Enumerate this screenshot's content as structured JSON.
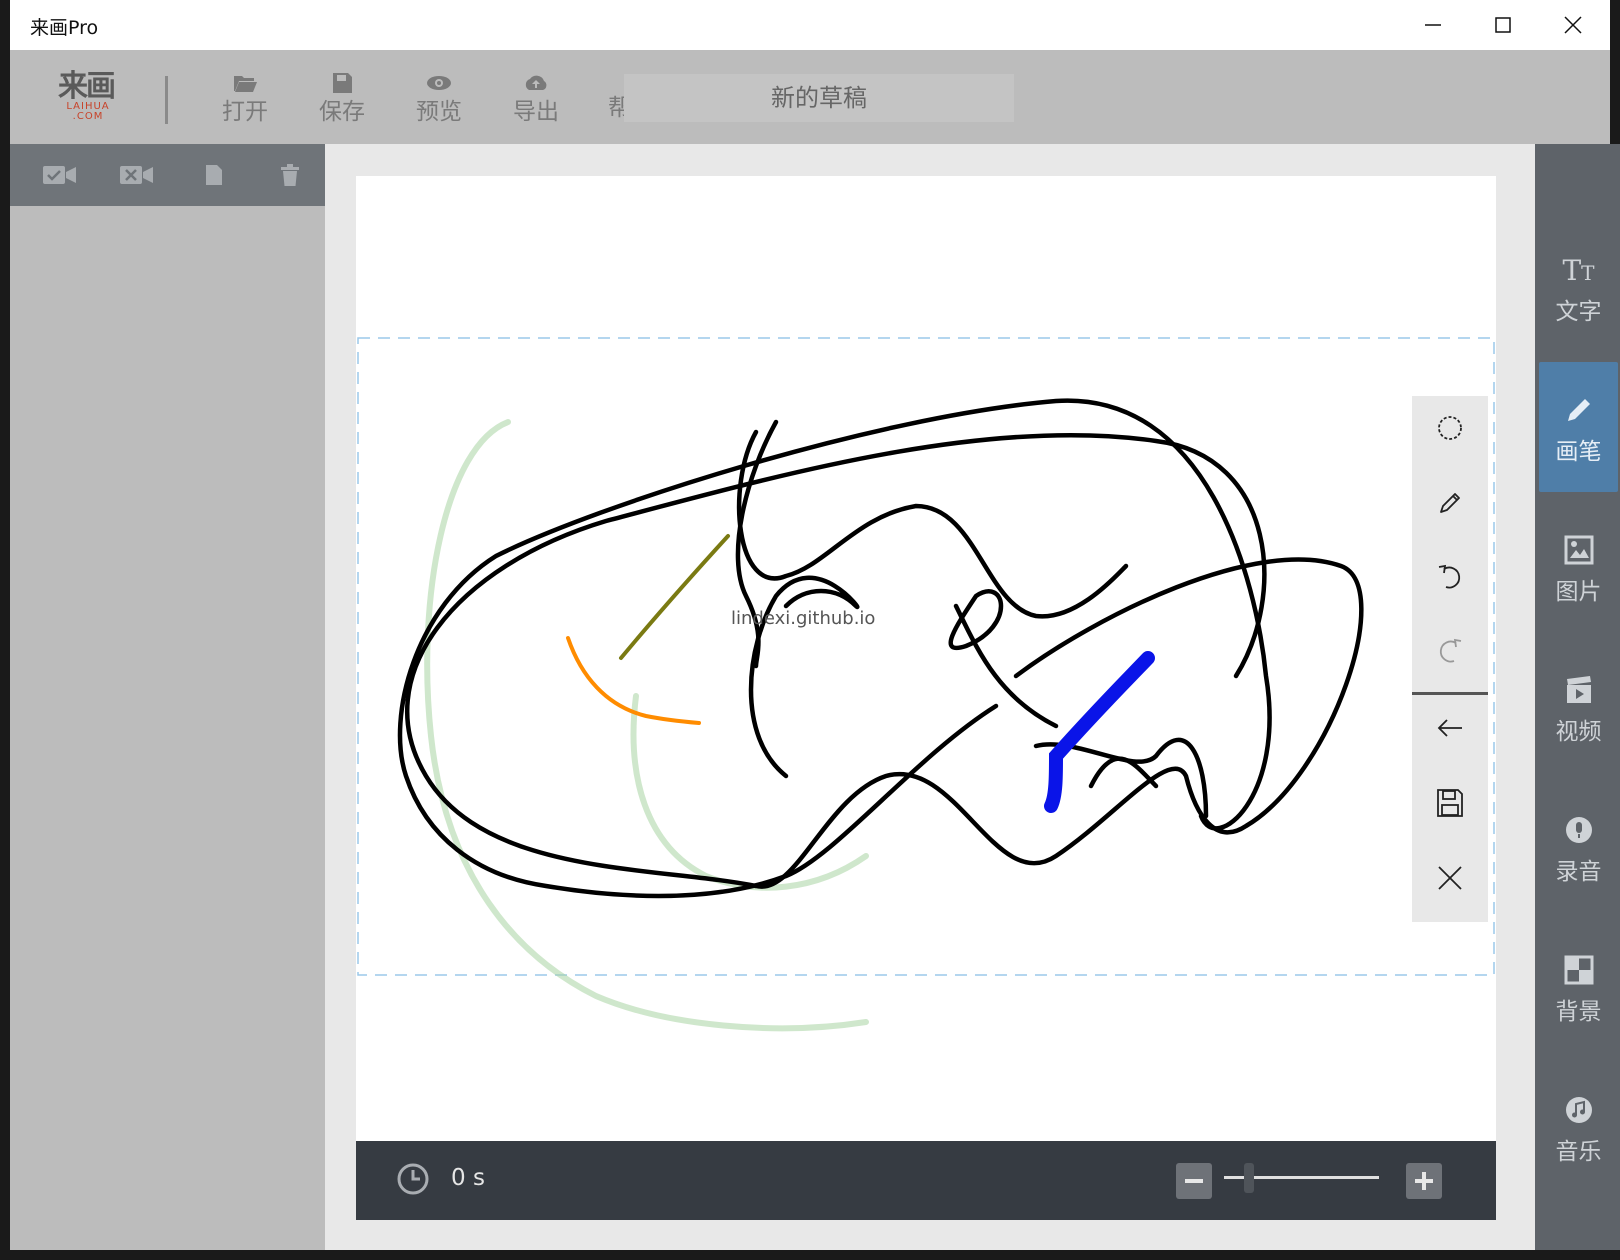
{
  "window": {
    "title": "来画Pro"
  },
  "toolbar": {
    "logo_cn": "来画",
    "logo_en": "LAIHUA",
    "logo_com": ".COM",
    "buttons": [
      {
        "label": "打开",
        "icon": "folder-open-icon"
      },
      {
        "label": "保存",
        "icon": "save-icon"
      },
      {
        "label": "预览",
        "icon": "eye-icon"
      },
      {
        "label": "导出",
        "icon": "cloud-upload-icon"
      },
      {
        "label": "帮助",
        "icon": "help-icon"
      }
    ],
    "document_title": "新的草稿"
  },
  "left_panel": {
    "tools": [
      "video-check-icon",
      "video-cross-icon",
      "page-icon",
      "trash-icon"
    ]
  },
  "canvas": {
    "watermark": "lindexi.github.io",
    "stroke_colors": {
      "ink": "#000000",
      "faint_green": "#a8d4a3",
      "olive": "#7a7a12",
      "orange": "#ff8c00",
      "blue": "#0a14e8"
    }
  },
  "pen_tools": [
    "circle-dashed-icon",
    "pencil-icon",
    "undo-icon",
    "redo-icon",
    "back-arrow-icon",
    "save-icon",
    "close-icon"
  ],
  "timeline": {
    "time": "0 s"
  },
  "right_panel": {
    "items": [
      {
        "label": "文字",
        "icon": "text-icon",
        "active": false
      },
      {
        "label": "画笔",
        "icon": "brush-icon",
        "active": true
      },
      {
        "label": "图片",
        "icon": "image-icon",
        "active": false
      },
      {
        "label": "视频",
        "icon": "video-icon",
        "active": false
      },
      {
        "label": "录音",
        "icon": "microphone-icon",
        "active": false
      },
      {
        "label": "背景",
        "icon": "background-icon",
        "active": false
      },
      {
        "label": "音乐",
        "icon": "music-icon",
        "active": false
      }
    ]
  },
  "colors": {
    "toolbar_bg": "#bcbcbc",
    "right_panel_bg": "#5e6369",
    "active_accent": "#4f7ea8",
    "timeline_bg": "#363b42"
  }
}
